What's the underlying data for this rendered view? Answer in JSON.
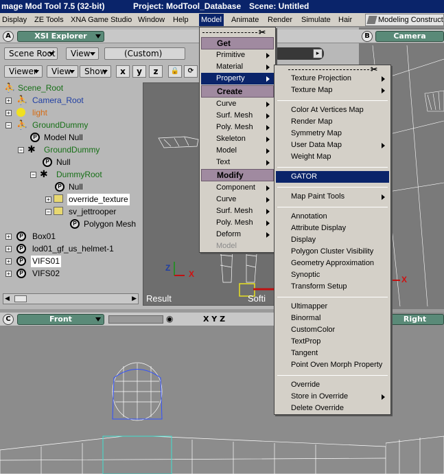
{
  "titlebar": {
    "app": "mage Mod Tool 7.5 (32-bit)",
    "project": "Project: ModTool_Database",
    "scene": "Scene: Untitled"
  },
  "menubar": {
    "items": [
      "Display",
      "ZE Tools",
      "XNA Game Studio",
      "Window",
      "Help",
      "Model",
      "Animate",
      "Render",
      "Simulate",
      "Hair"
    ],
    "layout_button": "Modeling Construct"
  },
  "explorer": {
    "panel_letter": "A",
    "title": "XSI Explorer",
    "scope_button": "Scene Root",
    "view_button": "View",
    "filter_button": "(Custom)",
    "viewer_button": "Viewer",
    "view2_button": "View",
    "show_button": "Show",
    "axis_x": "x",
    "axis_y": "y",
    "axis_z": "z",
    "tree": [
      {
        "label": "Scene_Root"
      },
      {
        "label": "Camera_Root"
      },
      {
        "label": "light"
      },
      {
        "label": "GroundDummy"
      },
      {
        "label": "Model Null"
      },
      {
        "label": "GroundDummy"
      },
      {
        "label": "Null"
      },
      {
        "label": "DummyRoot"
      },
      {
        "label": "Null"
      },
      {
        "label": "override_texture"
      },
      {
        "label": "sv_jettrooper"
      },
      {
        "label": "Polygon Mesh"
      },
      {
        "label": "Box01"
      },
      {
        "label": "lod01_gf_us_helmet-1"
      },
      {
        "label": "VIFS01"
      },
      {
        "label": "VIFS02"
      }
    ]
  },
  "viewport": {
    "result_label": "Result",
    "softimage_label": "Softi",
    "axis_z": "Z",
    "axis_x": "X",
    "right_axis_x": "X"
  },
  "camera_panel": {
    "letter": "B",
    "title": "Camera"
  },
  "front_panel": {
    "letter": "C",
    "title": "Front",
    "axes": "X Y Z"
  },
  "right_panel": {
    "title": "Right"
  },
  "model_menu": {
    "tear": "✂",
    "sections": {
      "get": "Get",
      "create": "Create",
      "modify": "Modify"
    },
    "get_items": [
      "Primitive",
      "Material",
      "Property"
    ],
    "create_items": [
      "Curve",
      "Surf. Mesh",
      "Poly. Mesh",
      "Skeleton",
      "Model",
      "Text"
    ],
    "modify_items": [
      "Component",
      "Curve",
      "Surf. Mesh",
      "Poly. Mesh",
      "Deform",
      "Model"
    ]
  },
  "property_menu": {
    "tear": "✂",
    "group1": [
      "Texture Projection",
      "Texture Map"
    ],
    "group2": [
      "Color At Vertices Map",
      "Render Map",
      "Symmetry Map",
      "User Data Map",
      "Weight Map"
    ],
    "group3": [
      "GATOR"
    ],
    "group4": [
      "Map Paint Tools"
    ],
    "group5": [
      "Annotation",
      "Attribute Display",
      "Display",
      "Polygon Cluster Visibility",
      "Geometry Approximation",
      "Synoptic",
      "Transform Setup"
    ],
    "group6": [
      "Ultimapper",
      "Binormal",
      "CustomColor",
      "TextProp",
      "Tangent",
      "Point Oven Morph Property"
    ],
    "group7": [
      "Override",
      "Store in Override",
      "Delete Override"
    ]
  },
  "colors": {
    "highlight": "#0a246a",
    "section_header": "#a08aa0",
    "tree_green": "#166f16",
    "tree_blue": "#1f3ea3",
    "light_orange": "#d66c14"
  }
}
